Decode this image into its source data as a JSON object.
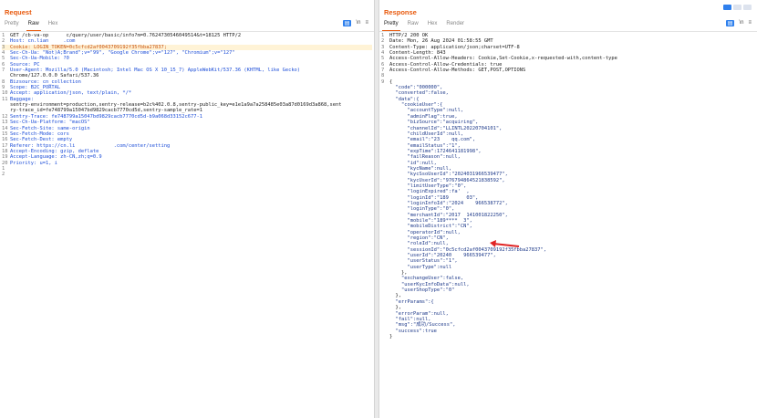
{
  "request": {
    "title": "Request",
    "tabs": [
      "Pretty",
      "Raw",
      "Hex"
    ],
    "toolbar": [
      "▤",
      "\\n",
      "≡"
    ],
    "lines": [
      "GET /cb-va-op      c/query/user/basic/info?m=0.7624730546049514&t=18125 HTTP/2",
      "Host: cn.lian     .com",
      "Cookie: LOGIN_TOKEN=0c5cfcd2af0043709192f35fbba27837;",
      "Sec-Ch-Ua: \"Not)A;Brand\";v=\"99\", \"Google Chrome\";v=\"127\", \"Chromium\";v=\"127\"",
      "Sec-Ch-Ua-Mobile: ?0",
      "Source: PC",
      "User-Agent: Mozilla/5.0 (Macintosh; Intel Mac OS X 10_15_7) AppleWebKit/537.36 (KHTML, like Gecko)",
      "Chrome/127.0.0.0 Safari/537.36",
      "Bizsource: cn_collection",
      "Scope: B2C_PORTAL",
      "Accept: application/json, text/plain, */*",
      "Baggage:",
      "sentry-environment=production,sentry-release=b2c%402.0.8,sentry-public_key=e1e1a9a7a258485e03a87d0169d3a868,sent",
      "ry-trace_id=fe748799a15047bd9829cacb7770cd5d,sentry-sample_rate=1",
      "Sentry-Trace: fe748799a15047bd9829cacb7770cd5d-b9a068d33152c677-1",
      "Sec-Ch-Ua-Platform: \"macOS\"",
      "Sec-Fetch-Site: same-origin",
      "Sec-Fetch-Mode: cors",
      "Sec-Fetch-Dest: empty",
      "Referer: https://cn.li             .com/center/setting",
      "Accept-Encoding: gzip, deflate",
      "Accept-Language: zh-CN,zh;q=0.9",
      "Priority: u=1, i",
      "",
      ""
    ],
    "line_numbers": [
      "1",
      "2",
      "3",
      "4",
      "5",
      "6",
      "7",
      "",
      "8",
      "9",
      "10",
      "11",
      "",
      "",
      "12",
      "13",
      "14",
      "15",
      "16",
      "17",
      "18",
      "19",
      "20",
      "1",
      "2"
    ]
  },
  "response": {
    "title": "Response",
    "tabs": [
      "Pretty",
      "Raw",
      "Hex",
      "Render"
    ],
    "toolbar": [
      "▤",
      "\\n",
      "≡"
    ],
    "lines": [
      "HTTP/2 200 OK",
      "Date: Mon, 26 Aug 2024 01:58:55 GMT",
      "Content-Type: application/json;charset=UTF-8",
      "Content-Length: 843",
      "Access-Control-Allow-Headers: Cookie,Set-Cookie,x-requested-with,content-type",
      "Access-Control-Allow-Credentials: true",
      "Access-Control-Allow-Methods: GET,POST,OPTIONS",
      "",
      "{",
      "  \"code\":\"000000\",",
      "  \"converted\":false,",
      "  \"data\":{",
      "    \"cookieUser\":{",
      "      \"accountType\":null,",
      "      \"adminFlag\":true,",
      "      \"bizSource\":\"acquiring\",",
      "      \"channelId\":\"LLINTL20220704101\",",
      "      \"childUserId\":null,",
      "      \"email\":\"23    qq.com\",",
      "      \"emailStatus\":\"1\",",
      "      \"expTime\":1724641181998\",",
      "      \"failReason\":null,",
      "      \"id\":null,",
      "      \"kycName\":null,",
      "      \"kycSsoUserId\":\"2024031966539477\",",
      "      \"kycUserId\":\"976794864521838592\",",
      "      \"limitUserType\":\"0\",",
      "      \"loginExpired\":fa'  ,",
      "      \"loginId\":\"189      03\",",
      "      \"loginInfoId\":\"2024    966538772\",",
      "      \"loginType\":\"0\",",
      "      \"merchantId\":\"2017  141001822250\",",
      "      \"mobile\":\"189****  3\",",
      "      \"mobileDistrict\":\"CN\",",
      "      \"operatorId\":null,",
      "      \"region\":\"CN\",",
      "      \"roleId\":null,",
      "      \"sessionId\":\"0c5cfcd2af0043709192f35fbba27837\",",
      "      \"userId\":\"20240    966539477\",",
      "      \"userStatus\":\"1\",",
      "      \"userType\":null",
      "    },",
      "    \"exchangeUser\":false,",
      "    \"userKycInfoData\":null,",
      "    \"userShopType\":\"0\"",
      "  },",
      "  \"errParams\":{",
      "  },",
      "  \"errorParam\":null,",
      "  \"fail\":null,",
      "  \"msg\":\"成功/Success\",",
      "  \"success\":true",
      "}"
    ],
    "line_numbers": [
      "1",
      "2",
      "3",
      "4",
      "5",
      "6",
      "7",
      "8",
      "9",
      "",
      "",
      "",
      "",
      "",
      "",
      "",
      "",
      "",
      "",
      "",
      "",
      "",
      "",
      "",
      "",
      "",
      "",
      "",
      "",
      "",
      "",
      "",
      "",
      "",
      "",
      "",
      "",
      "",
      "",
      "",
      "",
      "",
      "",
      "",
      "",
      "",
      "",
      "",
      "",
      "",
      "",
      "",
      ""
    ]
  },
  "window_controls": [
    "split-horizontal",
    "split-vertical",
    "single"
  ]
}
